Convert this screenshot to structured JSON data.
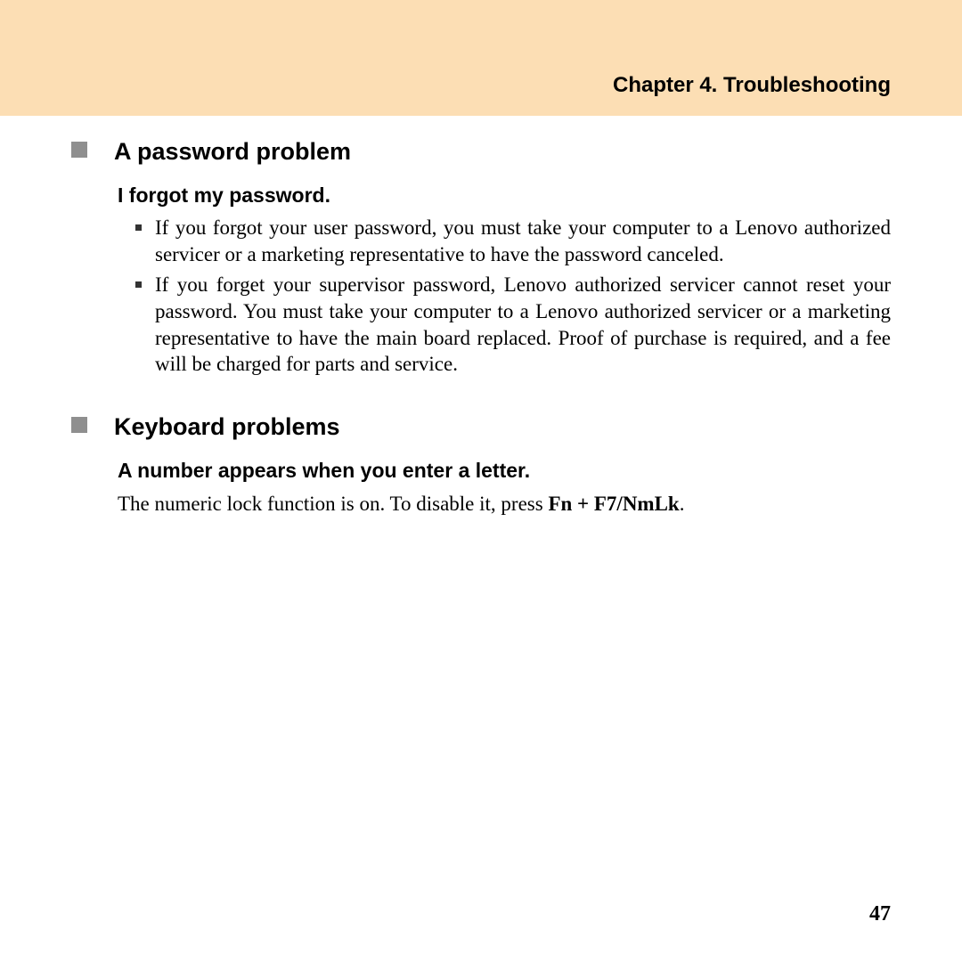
{
  "header": {
    "chapter_title": "Chapter 4. Troubleshooting"
  },
  "sections": [
    {
      "title": "A password problem",
      "sub_title": "I forgot my password.",
      "bullets": [
        "If you forgot your user password, you must take your computer to a Lenovo authorized servicer or a marketing representative to have the password canceled.",
        "If you forget your supervisor password, Lenovo authorized servicer cannot reset your password. You must take your computer to a Lenovo authorized servicer or a marketing representative to have the main board replaced. Proof of purchase is required, and a fee will be charged for parts and service."
      ]
    },
    {
      "title": "Keyboard problems",
      "sub_title": "A number appears when you enter a letter.",
      "body_prefix": "The numeric lock function is on. To disable it, press ",
      "body_bold": "Fn + F7/NmLk",
      "body_suffix": "."
    }
  ],
  "page_number": "47"
}
